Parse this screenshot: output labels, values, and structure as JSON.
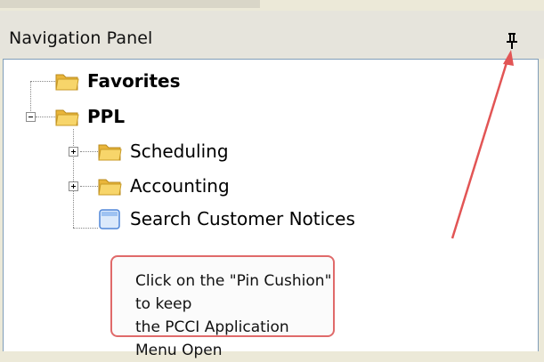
{
  "panel": {
    "title": "Navigation Panel",
    "pin_icon": "pushpin-icon"
  },
  "tree": {
    "items": [
      {
        "label": "Favorites",
        "icon": "folder-icon",
        "bold": true,
        "expander": "none"
      },
      {
        "label": "PPL",
        "icon": "folder-icon",
        "bold": true,
        "expander": "collapse"
      },
      {
        "label": "Scheduling",
        "icon": "folder-icon",
        "bold": false,
        "expander": "expand"
      },
      {
        "label": "Accounting",
        "icon": "folder-icon",
        "bold": false,
        "expander": "expand"
      },
      {
        "label": "Search Customer Notices",
        "icon": "page-icon",
        "bold": false,
        "expander": "none"
      }
    ]
  },
  "callout": {
    "line1": "Click on the \"Pin Cushion\" to keep",
    "line2": "the PCCI Application Menu Open"
  },
  "colors": {
    "callout_border": "#e06a6a",
    "arrow": "#e25555",
    "folder": "#f4c84c"
  }
}
